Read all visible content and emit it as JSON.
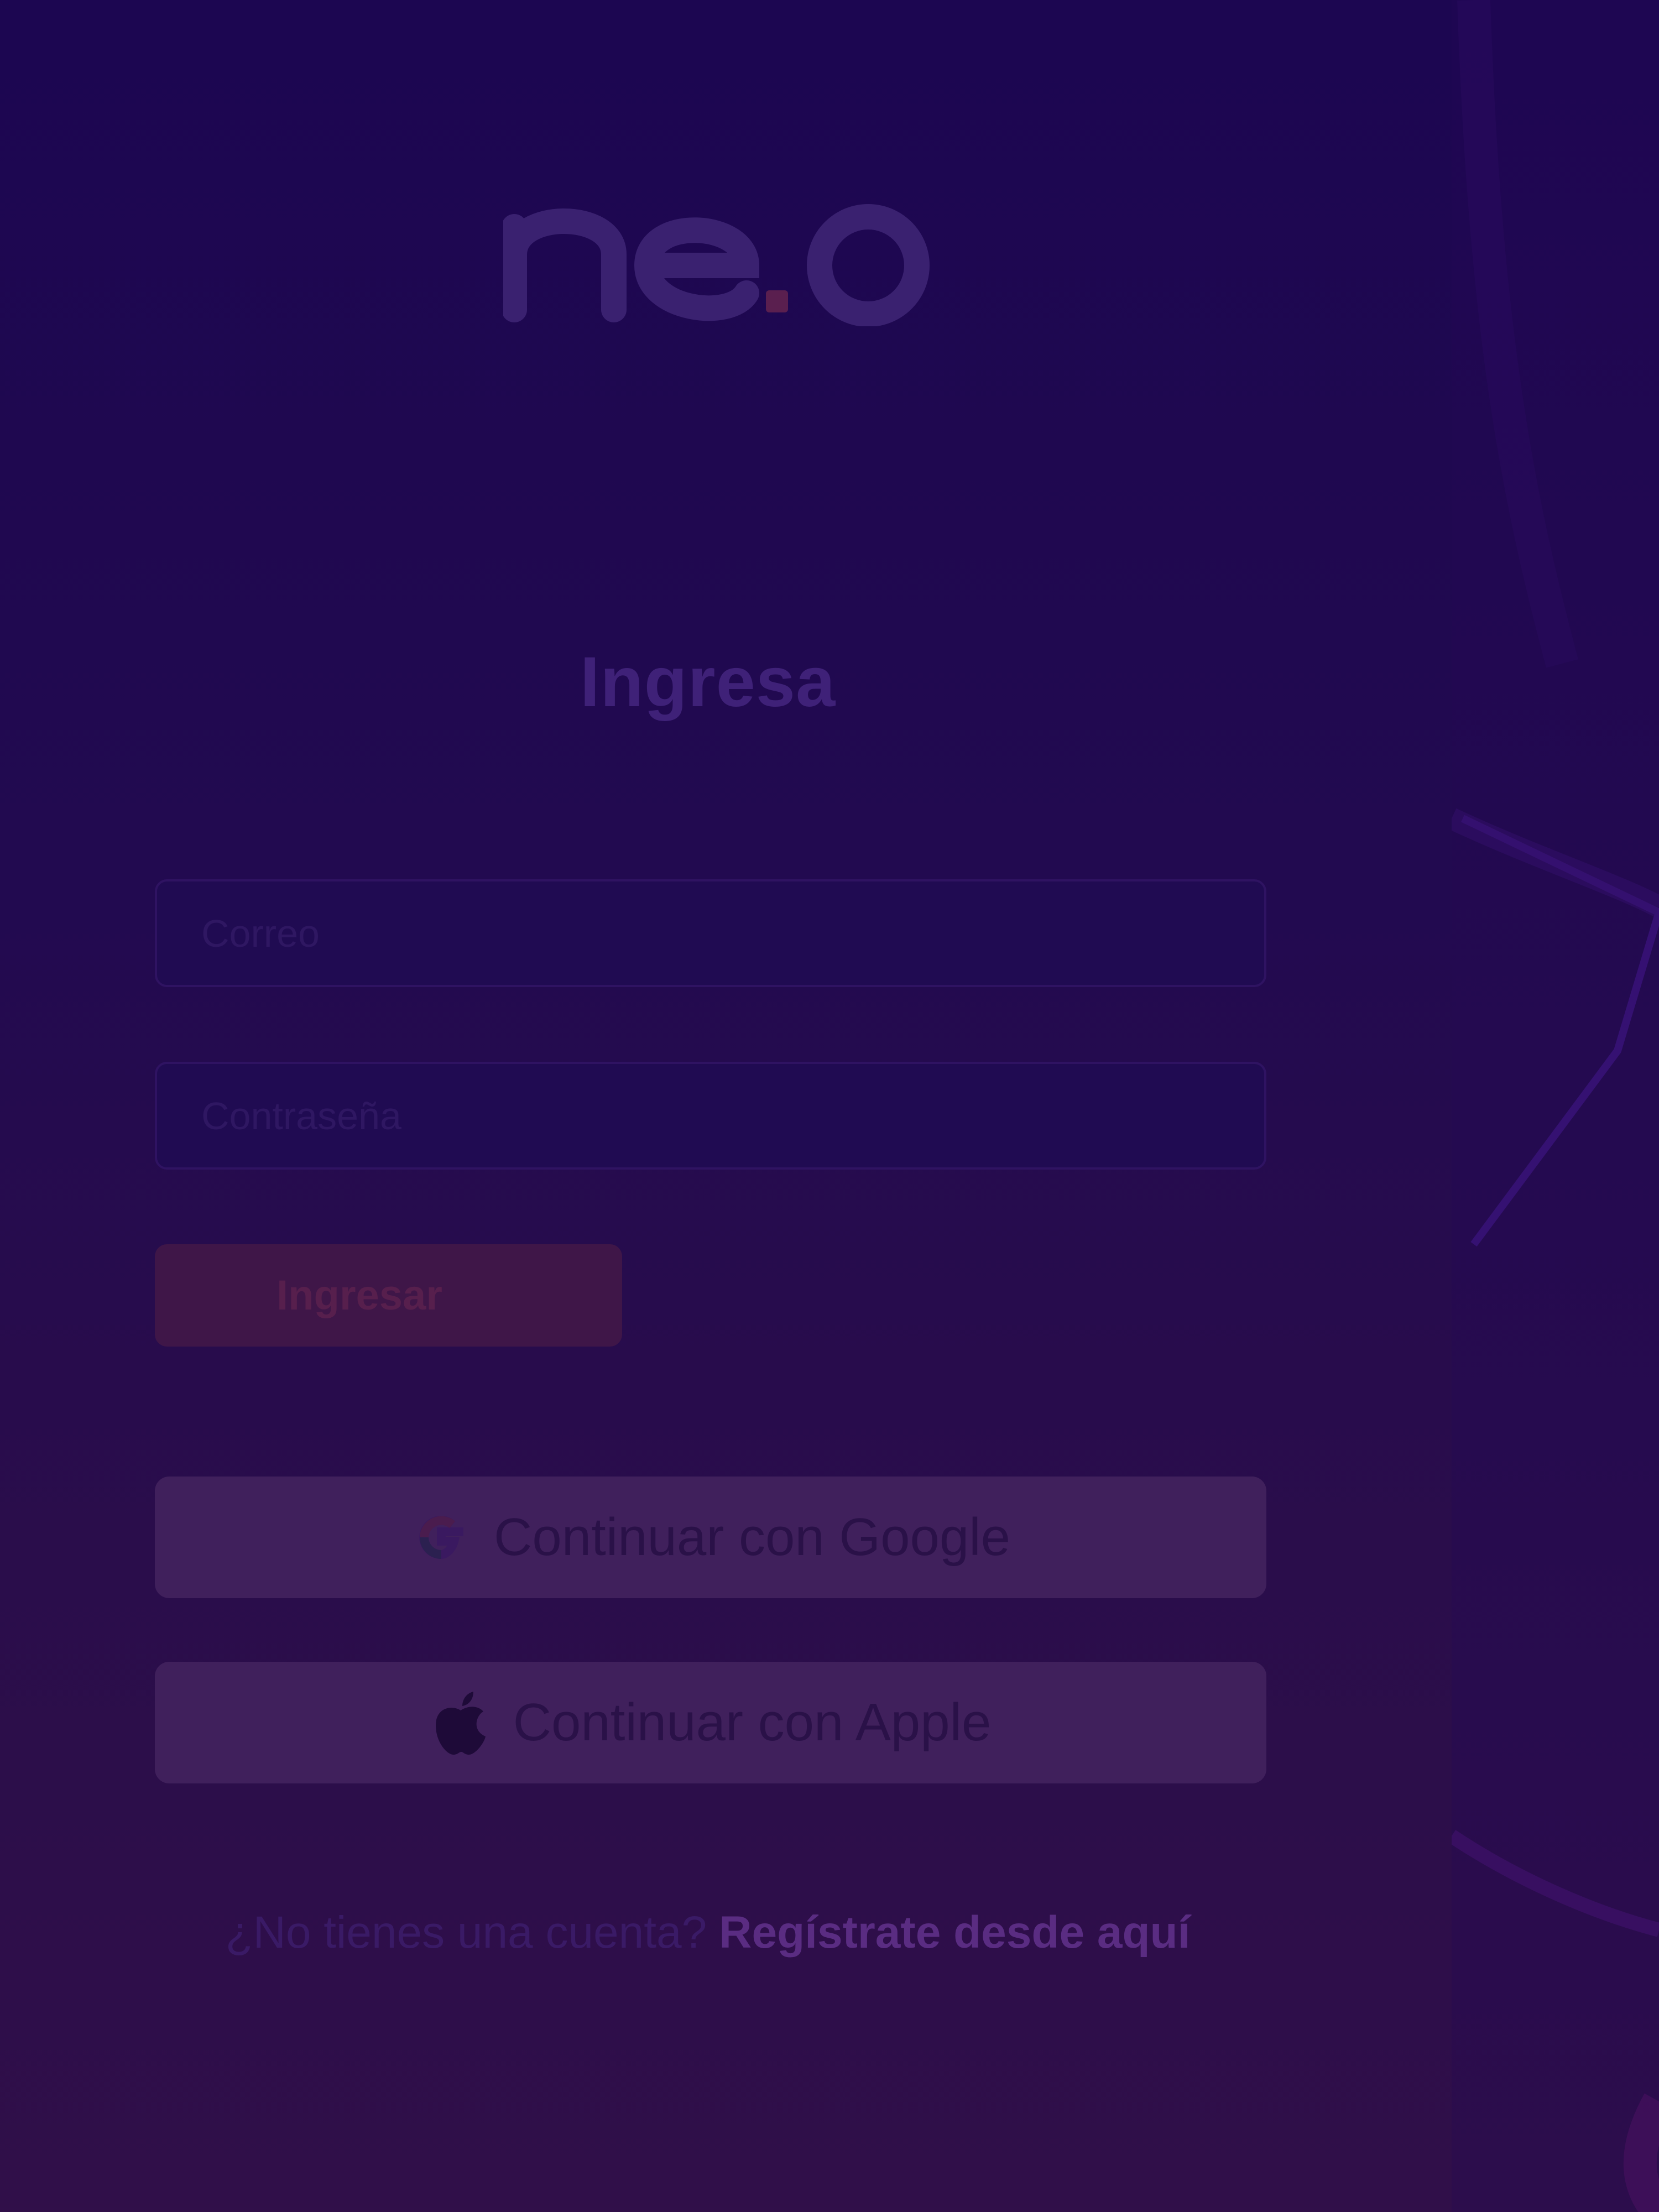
{
  "brand": {
    "name": "ne.o",
    "text_color": "#3a2170",
    "dot_color": "#5a1f4f"
  },
  "login": {
    "heading": "Ingresa",
    "email_placeholder": "Correo",
    "password_placeholder": "Contraseña",
    "submit_label": "Ingresar"
  },
  "social": {
    "google_label": "Continuar con Google",
    "apple_label": "Continuar con Apple",
    "google_icon": "google-icon",
    "apple_icon": "apple-icon"
  },
  "signup": {
    "prompt": "¿No tienes una cuenta?",
    "link_label": "Regístrate desde aquí"
  },
  "colors": {
    "background": "#1c0651",
    "primary_button": "#3f1648",
    "social_button": "#40205c"
  }
}
